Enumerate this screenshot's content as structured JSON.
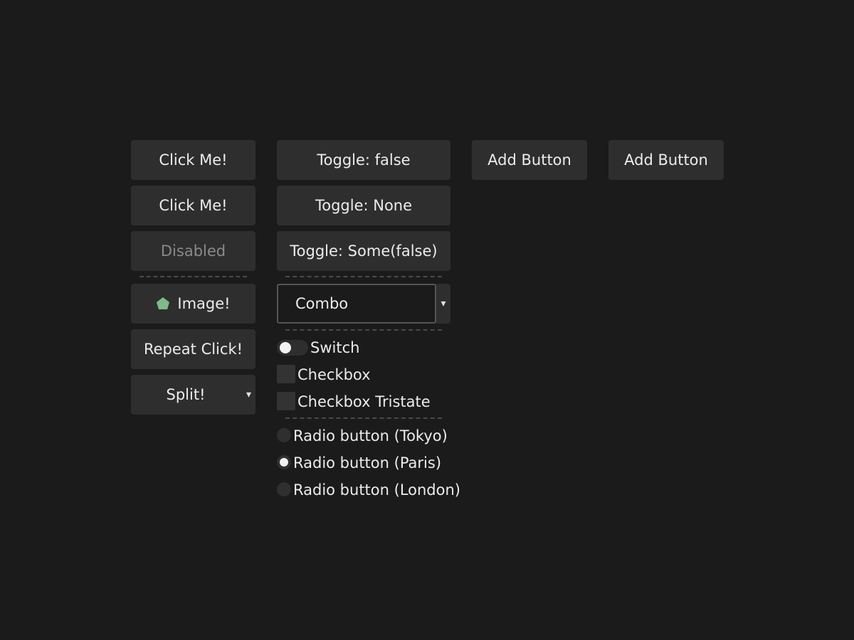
{
  "left_column": {
    "click_me_1": "Click Me!",
    "click_me_2": "Click Me!",
    "disabled": "Disabled",
    "image_button": "Image!",
    "repeat_click": "Repeat Click!",
    "split": "Split!",
    "split_arrow": "▾"
  },
  "toggles": {
    "toggle_bool": "Toggle: false",
    "toggle_none": "Toggle: None",
    "toggle_some": "Toggle: Some(false)"
  },
  "combo": {
    "value": "Combo",
    "arrow": "▾"
  },
  "switch": {
    "label": "Switch",
    "on": false
  },
  "checkboxes": [
    {
      "label": "Checkbox",
      "checked": false
    },
    {
      "label": "Checkbox Tristate",
      "checked": false
    }
  ],
  "radios": [
    {
      "label": "Radio button (Tokyo)",
      "selected": false
    },
    {
      "label": "Radio button (Paris)",
      "selected": true
    },
    {
      "label": "Radio button (London)",
      "selected": false
    }
  ],
  "add_buttons": [
    "Add Button",
    "Add Button"
  ],
  "colors": {
    "background": "#1b1b1b",
    "button": "#2e2e2e",
    "image_icon": "#7fba8a"
  }
}
